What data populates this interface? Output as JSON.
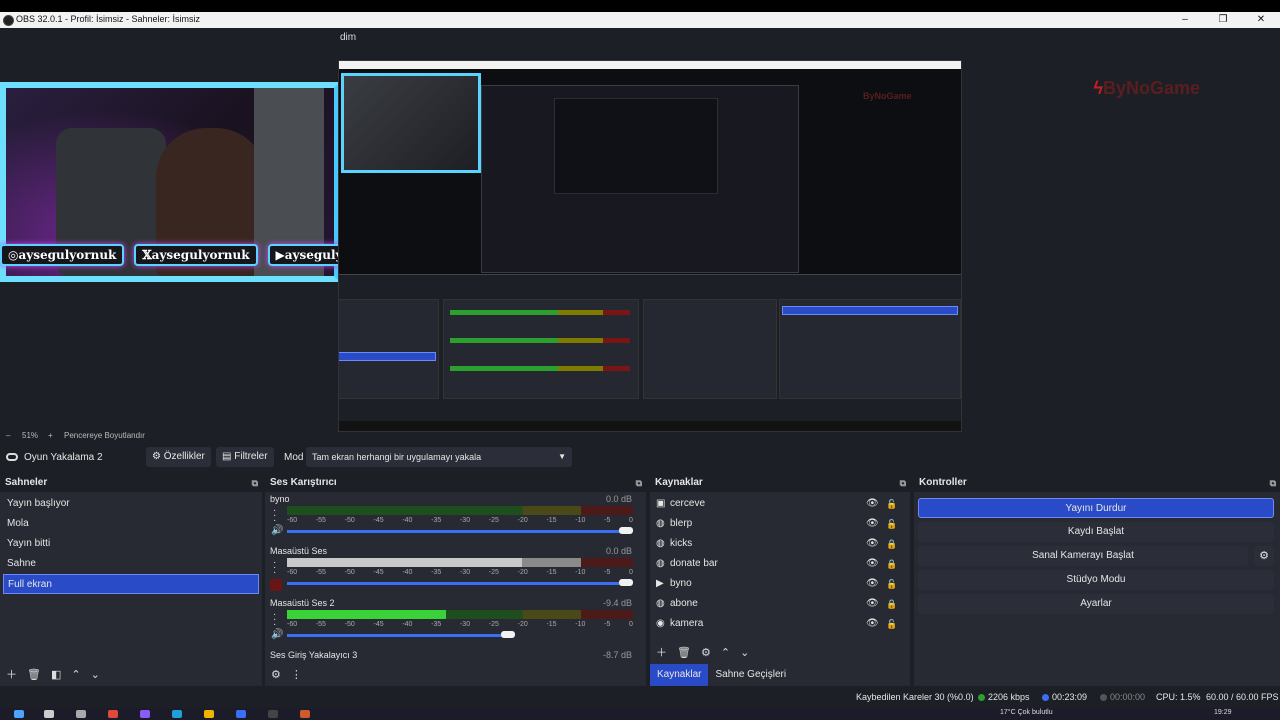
{
  "window": {
    "title": "OBS 32.0.1 - Profil: İsimsiz - Sahneler: İsimsiz",
    "minimize": "–",
    "maximize": "❐",
    "close": "✕"
  },
  "menubar": {
    "remnant": "dim"
  },
  "preview": {
    "socials": [
      "aysegulyornuk",
      "aysegulyornuk",
      "aysegulyornuk"
    ],
    "social_icons": [
      "instagram-icon",
      "x-icon",
      "youtube-icon"
    ],
    "brand": "ByNoGame",
    "nested_brand": "ByNoGame",
    "accent": "#5ad3ff",
    "glow": "#c44bff"
  },
  "zoombar": {
    "minus": "–",
    "zoom": "51%",
    "plus": "+",
    "fit": "Pencereye Boyutlandır"
  },
  "context": {
    "source_name": "Oyun Yakalama 2",
    "properties": "Özellikler",
    "filters": "Filtreler",
    "mode_label": "Mod",
    "mode_value": "Tam ekran herhangi bir uygulamayı yakala"
  },
  "scenes": {
    "title": "Sahneler",
    "items": [
      "Yayın başlıyor",
      "Mola",
      "Yayın bitti",
      "Sahne",
      "Full ekran"
    ],
    "active_index": 4
  },
  "mixer": {
    "title": "Ses Karıştırıcı",
    "scale": [
      "-60",
      "-55",
      "-50",
      "-45",
      "-40",
      "-35",
      "-30",
      "-25",
      "-20",
      "-15",
      "-10",
      "-5",
      "0"
    ],
    "channels": [
      {
        "name": "byno",
        "db": "0.0 dB",
        "level": 0,
        "volume": 1.0,
        "muted": false
      },
      {
        "name": "Masaüstü Ses",
        "db": "0.0 dB",
        "level": 0.85,
        "volume": 1.0,
        "muted": true
      },
      {
        "name": "Masaüstü Ses 2",
        "db": "-9.4 dB",
        "level": 0.46,
        "volume": 0.66,
        "muted": false
      }
    ],
    "partial_channel": {
      "name": "Ses Giriş Yakalayıcı 3",
      "db": "-8.7 dB"
    }
  },
  "sources": {
    "title": "Kaynaklar",
    "items": [
      {
        "label": "cerceve",
        "icon": "image-icon",
        "locked": false
      },
      {
        "label": "blerp",
        "icon": "browser-icon",
        "locked": false
      },
      {
        "label": "kicks",
        "icon": "browser-icon",
        "locked": true
      },
      {
        "label": "donate bar",
        "icon": "browser-icon",
        "locked": true
      },
      {
        "label": "byno",
        "icon": "media-icon",
        "locked": false
      },
      {
        "label": "abone",
        "icon": "browser-icon",
        "locked": true
      },
      {
        "label": "kamera",
        "icon": "camera-icon",
        "locked": false
      }
    ],
    "tabs": [
      "Kaynaklar",
      "Sahne Geçişleri"
    ]
  },
  "controls": {
    "title": "Kontroller",
    "stop_stream": "Yayını Durdur",
    "start_record": "Kaydı Başlat",
    "start_virtualcam": "Sanal Kamerayı Başlat",
    "studio_mode": "Stüdyo Modu",
    "settings": "Ayarlar"
  },
  "status": {
    "dropped": "Kaybedilen Kareler 30 (%0.0)",
    "bitrate": "2206 kbps",
    "stream_time": "00:23:09",
    "record_time": "00:00:00",
    "cpu": "CPU: 1.5%",
    "fps": "60.00 / 60.00 FPS",
    "bitrate_color": "#2ca02c",
    "stream_color": "#3a6ef5"
  },
  "taskbar": {
    "weather": "17°C  Çok bulutlu",
    "clock": "19:29"
  }
}
